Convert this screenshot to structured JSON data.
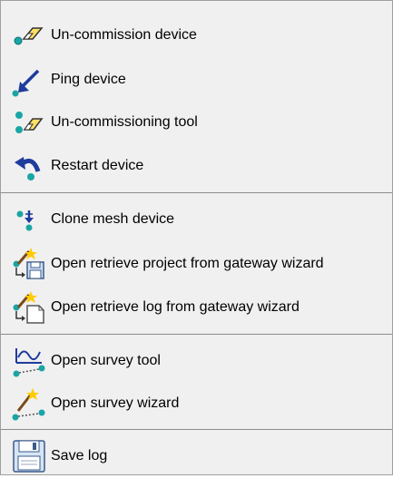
{
  "menu": {
    "items": [
      {
        "label": "Un-commission device",
        "icon": "eraser-node-icon"
      },
      {
        "label": "Ping device",
        "icon": "ping-arrow-icon"
      },
      {
        "label": "Un-commissioning tool",
        "icon": "eraser-nodes-icon"
      },
      {
        "label": "Restart device",
        "icon": "restart-arrow-icon"
      },
      {
        "label": "Clone mesh device",
        "icon": "clone-mesh-icon"
      },
      {
        "label": "Open retrieve project from gateway wizard",
        "icon": "wizard-project-icon"
      },
      {
        "label": "Open retrieve log from gateway wizard",
        "icon": "wizard-log-icon"
      },
      {
        "label": "Open survey tool",
        "icon": "survey-wave-icon"
      },
      {
        "label": "Open survey wizard",
        "icon": "survey-wand-icon"
      },
      {
        "label": "Save log",
        "icon": "floppy-disk-icon"
      }
    ]
  },
  "colors": {
    "node": "#1aa5a5",
    "arrow": "#1e3c9c",
    "wand": "#7a4a1a",
    "sparkle": "#ffcc00"
  }
}
